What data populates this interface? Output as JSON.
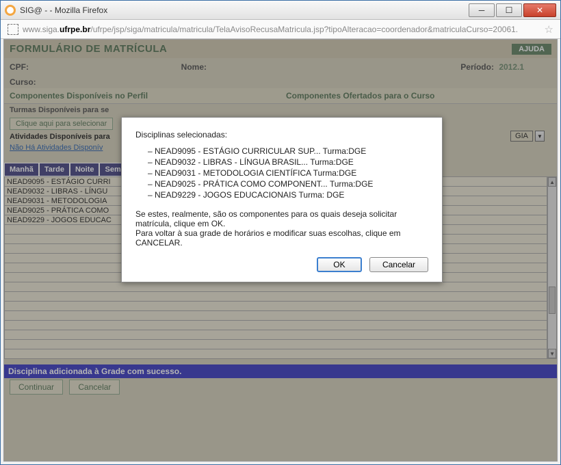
{
  "window": {
    "title": "SIG@ -  - Mozilla Firefox"
  },
  "url": {
    "prefix": "www.siga.",
    "bold": "ufrpe.br",
    "rest": "/ufrpe/jsp/siga/matricula/matricula/TelaAvisoRecusaMatricula.jsp?tipoAlteracao=coordenador&matriculaCurso=20061."
  },
  "page": {
    "title": "FORMULÁRIO DE MATRÍCULA",
    "help": "AJUDA",
    "labels": {
      "cpf": "CPF:",
      "nome": "Nome:",
      "periodo": "Período:",
      "curso": "Curso:"
    },
    "periodo_value": "2012.1",
    "section_left": "Componentes Disponíveis no Perfil",
    "section_right": "Componentes Ofertados para o Curso",
    "turmas": "Turmas Disponíveis para se",
    "click": "Clique aqui para selecionar",
    "atividades": "Atividades Disponíveis para",
    "no_ativ": "Não Há Atividades Disponív",
    "gia_label": "GIA",
    "tabs": [
      "Manhã",
      "Tarde",
      "Noite",
      "Sem"
    ],
    "rows": [
      "NEAD9095 - ESTÁGIO CURRI",
      "NEAD9032 - LIBRAS - LÍNGU",
      "NEAD9031 - METODOLOGIA",
      "NEAD9025 - PRÁTICA COMO",
      "NEAD9229 - JOGOS EDUCAC"
    ],
    "success": "Disciplina adicionada à Grade com sucesso.",
    "continuar": "Continuar",
    "cancelar": "Cancelar"
  },
  "modal": {
    "heading": "Disciplinas selecionadas:",
    "items": [
      "NEAD9095 - ESTÁGIO CURRICULAR SUP... Turma:DGE",
      "NEAD9032 - LIBRAS - LÍNGUA BRASIL... Turma:DGE",
      "NEAD9031 - METODOLOGIA CIENTÍFICA Turma:DGE",
      "NEAD9025 - PRÁTICA COMO COMPONENT... Turma:DGE",
      "NEAD9229 - JOGOS EDUCACIONAIS Turma: DGE"
    ],
    "confirm1": "Se estes, realmente, são os componentes para os quais deseja solicitar matrícula, clique em OK.",
    "confirm2": "Para voltar à sua grade de horários e modificar suas escolhas, clique em CANCELAR.",
    "ok": "OK",
    "cancel": "Cancelar"
  }
}
